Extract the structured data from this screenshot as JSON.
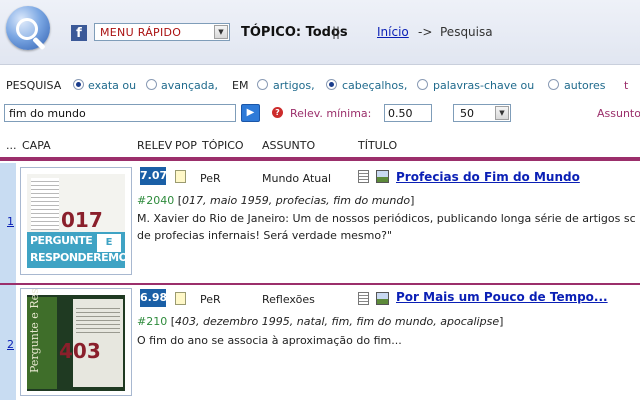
{
  "header": {
    "menu_label": "MENU RÁPIDO",
    "topic_label": "TÓPICO: Todos",
    "nav_separator": "||",
    "home_link": "Início",
    "arrow": "->",
    "breadcrumb_current": "Pesquisa"
  },
  "search_options": {
    "pesquisa_label": "PESQUISA",
    "mode_options": [
      {
        "label": "exata ou",
        "selected": true
      },
      {
        "label": "avançada,",
        "selected": false
      }
    ],
    "em_label": "EM",
    "field_options": [
      {
        "label": "artigos,",
        "selected": false
      },
      {
        "label": "cabeçalhos,",
        "selected": true
      },
      {
        "label": "palavras-chave ou",
        "selected": false
      },
      {
        "label": "autores",
        "selected": false
      }
    ],
    "trailing_char": "t"
  },
  "search_bar": {
    "query": "fim do mundo",
    "go_symbol": "▶",
    "help_symbol": "?",
    "relevance_label": "Relev. mínima:",
    "relevance_value": "0.50",
    "results_per_page": "50",
    "assunto_label": "Assunto"
  },
  "columns": {
    "lead": "...",
    "capa": "CAPA",
    "relev": "RELEV",
    "pop": "POP",
    "topico": "TÓPICO",
    "assunto": "ASSUNTO",
    "titulo": "TÍTULO"
  },
  "results": [
    {
      "number": "1",
      "score": "7.07",
      "per": "PeR",
      "topic": "Mundo Atual",
      "title": "Profecias do Fim do Mundo",
      "id": "#2040",
      "meta": "017, maio 1959, profecias, fim do mundo",
      "description_line1": "M. Xavier do Rio de Janeiro: Um de nossos periódicos, publicando longa série de artigos sc",
      "description_line2": "de profecias infernais! Será verdade mesmo?\"",
      "cover_number": "017",
      "cover_title_1": "PERGUNTE",
      "cover_title_2": "RESPONDEREMOS",
      "cover_letter": "E"
    },
    {
      "number": "2",
      "score": "6.98",
      "per": "PeR",
      "topic": "Reflexões",
      "title": "Por Mais um Pouco de Tempo...",
      "id": "#210",
      "meta": "403, dezembro 1995, natal, fim, fim do mundo, apocalipse",
      "description_line1": "O fim do ano se associa à aproximação do fim...",
      "cover_number": "403",
      "cover_vertical": "Pergunte e Responderemos"
    }
  ],
  "colors": {
    "accent": "#9b2f6b",
    "link": "#0a1fb5",
    "score_bg": "#1a5fa6",
    "id_green": "#2e8b3c"
  }
}
